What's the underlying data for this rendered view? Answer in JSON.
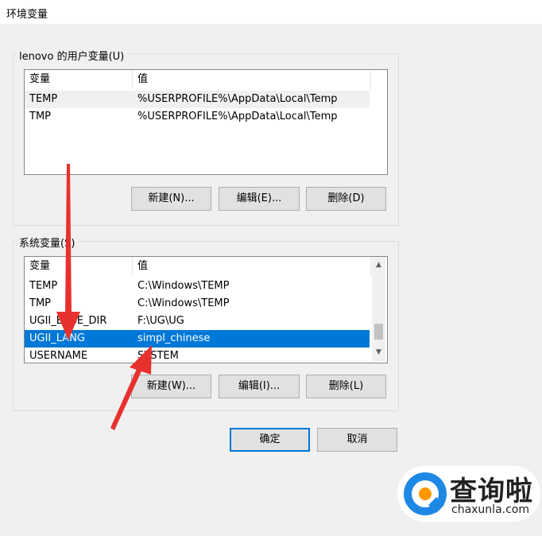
{
  "window": {
    "title": "环境变量"
  },
  "user_vars": {
    "group_label": "lenovo 的用户变量(U)",
    "col_variable": "变量",
    "col_value": "值",
    "rows": [
      {
        "name": "TEMP",
        "value": "%USERPROFILE%\\AppData\\Local\\Temp"
      },
      {
        "name": "TMP",
        "value": "%USERPROFILE%\\AppData\\Local\\Temp"
      }
    ],
    "buttons": {
      "new": "新建(N)...",
      "edit": "编辑(E)...",
      "delete": "删除(D)"
    }
  },
  "system_vars": {
    "group_label": "系统变量(S)",
    "col_variable": "变量",
    "col_value": "值",
    "rows": [
      {
        "name": "TEMP",
        "value": "C:\\Windows\\TEMP"
      },
      {
        "name": "TMP",
        "value": "C:\\Windows\\TEMP"
      },
      {
        "name": "UGII_BASE_DIR",
        "value": "F:\\UG\\UG"
      },
      {
        "name": "UGII_LANG",
        "value": "simpl_chinese"
      },
      {
        "name": "USERNAME",
        "value": "SYSTEM"
      }
    ],
    "selected_row": "UGII_LANG",
    "buttons": {
      "new": "新建(W)...",
      "edit": "编辑(I)...",
      "delete": "删除(L)"
    }
  },
  "dialog_buttons": {
    "ok": "确定",
    "cancel": "取消"
  },
  "watermark": {
    "text_cn": "查询啦",
    "text_en": "chaxunla.com"
  },
  "colors": {
    "selection": "#0078d7",
    "annotation_arrow": "#e8312e",
    "logo_blue": "#1e88e5",
    "logo_orange": "#ff9800"
  },
  "icons": {
    "scroll_up": "chevron-up-icon",
    "scroll_down": "chevron-down-icon"
  }
}
